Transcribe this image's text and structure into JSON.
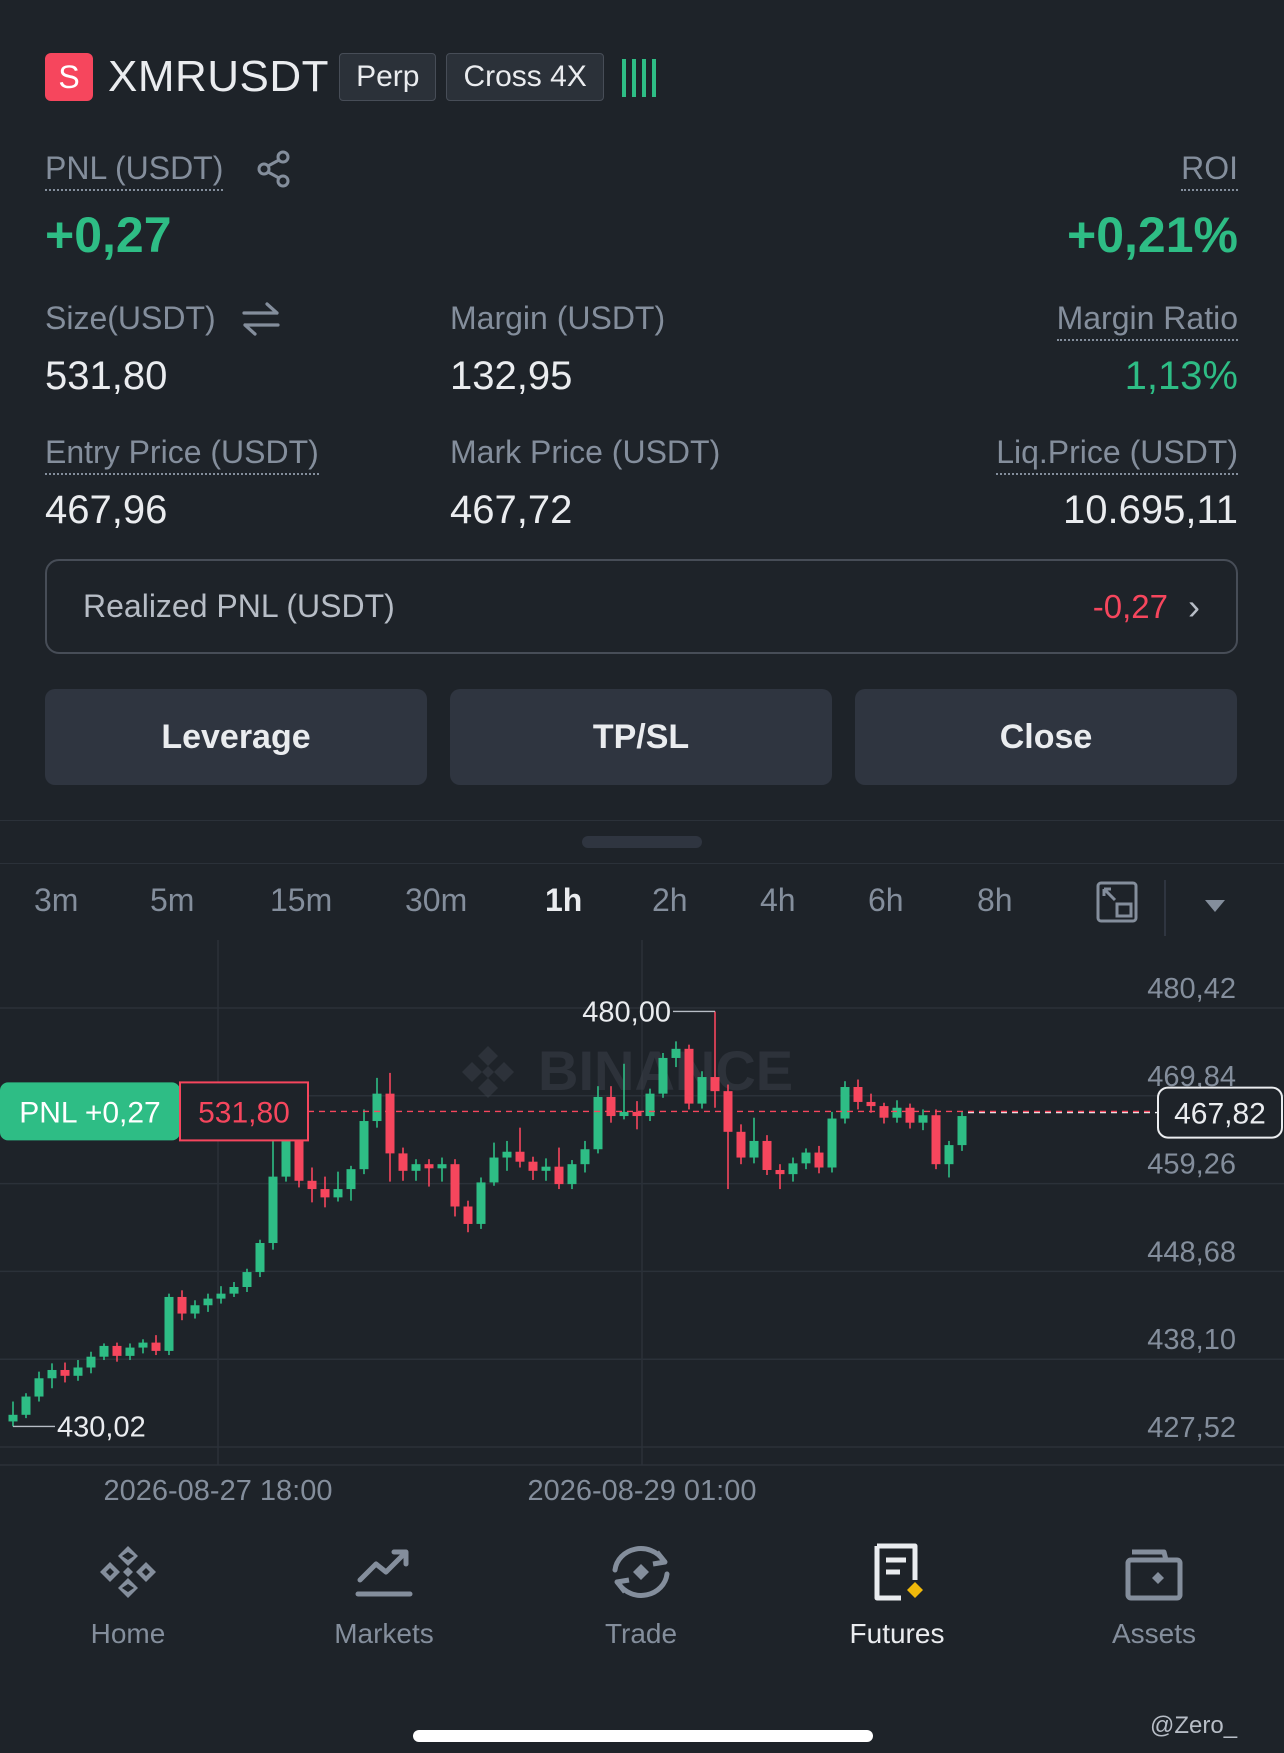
{
  "header": {
    "badge": "S",
    "symbol": "XMRUSDT",
    "tag_type": "Perp",
    "tag_margin": "Cross 4X"
  },
  "position": {
    "pnl_label": "PNL (USDT)",
    "pnl_value": "+0,27",
    "roi_label": "ROI",
    "roi_value": "+0,21%",
    "size_label": "Size(USDT)",
    "size_value": "531,80",
    "margin_label": "Margin (USDT)",
    "margin_value": "132,95",
    "margin_ratio_label": "Margin Ratio",
    "margin_ratio_value": "1,13%",
    "entry_label": "Entry Price (USDT)",
    "entry_value": "467,96",
    "mark_label": "Mark Price (USDT)",
    "mark_value": "467,72",
    "liq_label": "Liq.Price (USDT)",
    "liq_value": "10.695,11",
    "realized_label": "Realized PNL (USDT)",
    "realized_value": "-0,27"
  },
  "actions": {
    "leverage": "Leverage",
    "tpsl": "TP/SL",
    "close": "Close"
  },
  "timeframes": [
    "3m",
    "5m",
    "15m",
    "30m",
    "1h",
    "2h",
    "4h",
    "6h",
    "8h"
  ],
  "active_timeframe": "1h",
  "chart_data": {
    "type": "candlestick",
    "watermark": "BINANCE",
    "y_ticks": [
      "480,42",
      "469,84",
      "459,26",
      "448,68",
      "438,10",
      "427,52"
    ],
    "y_tick_values": [
      480.42,
      469.84,
      459.26,
      448.68,
      438.1,
      427.52
    ],
    "ylim": [
      427.52,
      480.42
    ],
    "x_ticks": [
      "2026-08-27 18:00",
      "2026-08-29 01:00"
    ],
    "high_label": "480,00",
    "low_label": "430,02",
    "current_price": "467,82",
    "current_price_value": 467.82,
    "position_pnl": "PNL +0,27",
    "position_size": "531,80",
    "entry_price_value": 467.96,
    "candles": [
      [
        430.6,
        431.4,
        433.0,
        430.0
      ],
      [
        431.4,
        433.6,
        434.0,
        431.0
      ],
      [
        433.6,
        435.8,
        436.6,
        433.0
      ],
      [
        435.8,
        436.8,
        437.6,
        434.6
      ],
      [
        436.8,
        436.1,
        437.7,
        435.3
      ],
      [
        436.1,
        437.1,
        438.0,
        435.5
      ],
      [
        437.1,
        438.4,
        439.0,
        436.4
      ],
      [
        438.4,
        439.7,
        440.0,
        438.0
      ],
      [
        439.7,
        438.5,
        440.1,
        437.8
      ],
      [
        438.5,
        439.5,
        440.0,
        438.0
      ],
      [
        439.5,
        440.1,
        440.5,
        438.8
      ],
      [
        440.1,
        439.1,
        441.0,
        438.6
      ],
      [
        439.1,
        445.6,
        446.0,
        438.6
      ],
      [
        445.6,
        443.6,
        446.4,
        442.8
      ],
      [
        443.6,
        444.6,
        445.2,
        443.0
      ],
      [
        444.6,
        445.4,
        446.0,
        443.8
      ],
      [
        445.4,
        446.0,
        446.9,
        444.8
      ],
      [
        446.0,
        446.8,
        447.4,
        445.6
      ],
      [
        446.8,
        448.6,
        449.0,
        446.2
      ],
      [
        448.6,
        452.1,
        452.5,
        448.0
      ],
      [
        452.1,
        460.1,
        466.0,
        451.3
      ],
      [
        460.1,
        466.4,
        471.0,
        459.5
      ],
      [
        466.4,
        459.6,
        467.0,
        458.8
      ],
      [
        459.6,
        458.6,
        461.2,
        457.0
      ],
      [
        458.6,
        457.6,
        460.1,
        456.4
      ],
      [
        457.6,
        458.6,
        460.7,
        457.1
      ],
      [
        458.6,
        461.0,
        461.4,
        457.2
      ],
      [
        461.0,
        466.8,
        468.2,
        460.4
      ],
      [
        466.8,
        470.1,
        472.0,
        466.0
      ],
      [
        470.1,
        462.9,
        472.6,
        459.5
      ],
      [
        462.9,
        460.8,
        463.6,
        459.6
      ],
      [
        460.8,
        461.6,
        462.2,
        459.6
      ],
      [
        461.6,
        461.1,
        462.2,
        458.9
      ],
      [
        461.1,
        461.6,
        462.4,
        459.5
      ],
      [
        461.6,
        456.5,
        462.2,
        455.3
      ],
      [
        456.5,
        454.4,
        457.2,
        453.4
      ],
      [
        454.4,
        459.4,
        460.0,
        453.8
      ],
      [
        459.4,
        462.4,
        464.2,
        459.0
      ],
      [
        462.4,
        463.1,
        464.4,
        460.8
      ],
      [
        463.1,
        461.9,
        466.0,
        461.2
      ],
      [
        461.9,
        460.8,
        462.5,
        459.7
      ],
      [
        460.8,
        461.3,
        462.3,
        459.6
      ],
      [
        461.3,
        459.2,
        463.6,
        458.6
      ],
      [
        459.2,
        461.6,
        462.1,
        458.6
      ],
      [
        461.6,
        463.4,
        464.4,
        460.6
      ],
      [
        463.4,
        469.7,
        471.0,
        462.9
      ],
      [
        469.7,
        467.4,
        471.0,
        466.6
      ],
      [
        467.4,
        467.9,
        473.7,
        467.0
      ],
      [
        467.9,
        467.4,
        469.2,
        465.8
      ],
      [
        467.4,
        470.1,
        470.7,
        466.8
      ],
      [
        470.1,
        474.4,
        475.0,
        469.6
      ],
      [
        474.4,
        475.5,
        476.4,
        473.3
      ],
      [
        475.5,
        468.9,
        476.0,
        468.2
      ],
      [
        468.9,
        472.1,
        472.8,
        468.3
      ],
      [
        472.1,
        470.4,
        480.0,
        468.4
      ],
      [
        470.4,
        465.5,
        471.2,
        458.6
      ],
      [
        465.5,
        462.4,
        466.4,
        461.6
      ],
      [
        462.4,
        464.4,
        467.2,
        461.7
      ],
      [
        464.4,
        460.9,
        465.1,
        460.3
      ],
      [
        460.9,
        460.4,
        461.6,
        458.6
      ],
      [
        460.4,
        461.7,
        462.4,
        459.5
      ],
      [
        461.7,
        463.0,
        463.5,
        461.0
      ],
      [
        463.0,
        461.2,
        463.8,
        460.5
      ],
      [
        461.2,
        467.1,
        467.9,
        460.6
      ],
      [
        467.1,
        470.9,
        471.6,
        466.5
      ],
      [
        470.9,
        469.1,
        471.8,
        468.2
      ],
      [
        469.1,
        468.6,
        470.1,
        467.8
      ],
      [
        468.6,
        467.2,
        469.0,
        466.5
      ],
      [
        467.2,
        468.4,
        469.3,
        466.6
      ],
      [
        468.4,
        466.6,
        468.9,
        465.9
      ],
      [
        466.6,
        467.5,
        468.2,
        465.7
      ],
      [
        467.5,
        461.6,
        468.2,
        461.0
      ],
      [
        461.6,
        463.9,
        464.4,
        460.0
      ],
      [
        463.9,
        467.4,
        467.9,
        463.2
      ]
    ]
  },
  "nav": {
    "items": [
      {
        "label": "Home",
        "icon": "binance-logo-icon"
      },
      {
        "label": "Markets",
        "icon": "chart-trend-icon"
      },
      {
        "label": "Trade",
        "icon": "trade-swap-icon"
      },
      {
        "label": "Futures",
        "icon": "futures-document-icon"
      },
      {
        "label": "Assets",
        "icon": "wallet-icon"
      }
    ],
    "active": "Futures"
  },
  "watermark_user": "@Zero_"
}
